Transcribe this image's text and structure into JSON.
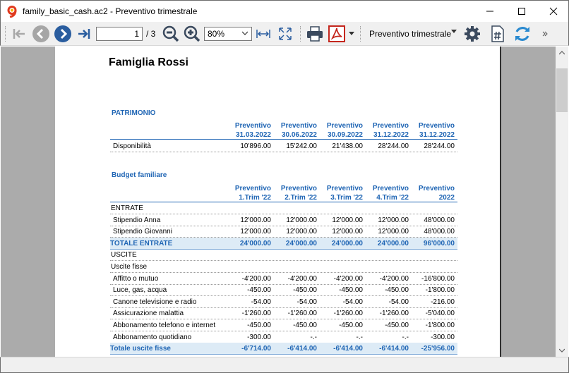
{
  "window": {
    "title": "family_basic_cash.ac2 - Preventivo trimestrale",
    "app_icon_color": "#e03a1e"
  },
  "toolbar": {
    "current_page": "1",
    "page_total": "/ 3",
    "zoom": "80%",
    "report_name": "Preventivo trimestrale"
  },
  "report": {
    "title": "Famiglia Rossi",
    "patrimonio": {
      "heading": "PATRIMONIO",
      "columns": [
        {
          "line1": "Preventivo",
          "line2": "31.03.2022"
        },
        {
          "line1": "Preventivo",
          "line2": "30.06.2022"
        },
        {
          "line1": "Preventivo",
          "line2": "30.09.2022"
        },
        {
          "line1": "Preventivo",
          "line2": "31.12.2022"
        },
        {
          "line1": "Preventivo",
          "line2": "31.12.2022"
        }
      ],
      "rows": [
        {
          "label": "Disponibilità",
          "values": [
            "10'896.00",
            "15'242.00",
            "21'438.00",
            "28'244.00",
            "28'244.00"
          ]
        }
      ]
    },
    "budget": {
      "heading": "Budget familiare",
      "columns": [
        {
          "line1": "Preventivo",
          "line2": "1.Trim '22"
        },
        {
          "line1": "Preventivo",
          "line2": "2.Trim '22"
        },
        {
          "line1": "Preventivo",
          "line2": "3.Trim '22"
        },
        {
          "line1": "Preventivo",
          "line2": "4.Trim '22"
        },
        {
          "line1": "Preventivo",
          "line2": "2022"
        }
      ],
      "rows": [
        {
          "label": "ENTRATE",
          "kind": "group",
          "values": [
            "",
            "",
            "",
            "",
            ""
          ]
        },
        {
          "label": "Stipendio Anna",
          "kind": "item",
          "values": [
            "12'000.00",
            "12'000.00",
            "12'000.00",
            "12'000.00",
            "48'000.00"
          ]
        },
        {
          "label": "Stipendio Giovanni",
          "kind": "item",
          "values": [
            "12'000.00",
            "12'000.00",
            "12'000.00",
            "12'000.00",
            "48'000.00"
          ]
        },
        {
          "label": "TOTALE ENTRATE",
          "kind": "total",
          "values": [
            "24'000.00",
            "24'000.00",
            "24'000.00",
            "24'000.00",
            "96'000.00"
          ]
        },
        {
          "label": "USCITE",
          "kind": "group",
          "values": [
            "",
            "",
            "",
            "",
            ""
          ]
        },
        {
          "label": "Uscite fisse",
          "kind": "group",
          "values": [
            "",
            "",
            "",
            "",
            ""
          ]
        },
        {
          "label": "Affitto o mutuo",
          "kind": "item",
          "values": [
            "-4'200.00",
            "-4'200.00",
            "-4'200.00",
            "-4'200.00",
            "-16'800.00"
          ]
        },
        {
          "label": "Luce, gas, acqua",
          "kind": "item",
          "values": [
            "-450.00",
            "-450.00",
            "-450.00",
            "-450.00",
            "-1'800.00"
          ]
        },
        {
          "label": "Canone televisione e radio",
          "kind": "item",
          "values": [
            "-54.00",
            "-54.00",
            "-54.00",
            "-54.00",
            "-216.00"
          ]
        },
        {
          "label": "Assicurazione malattia",
          "kind": "item",
          "values": [
            "-1'260.00",
            "-1'260.00",
            "-1'260.00",
            "-1'260.00",
            "-5'040.00"
          ]
        },
        {
          "label": "Abbonamento telefono e internet",
          "kind": "item",
          "values": [
            "-450.00",
            "-450.00",
            "-450.00",
            "-450.00",
            "-1'800.00"
          ]
        },
        {
          "label": "Abbonamento quotidiano",
          "kind": "item",
          "values": [
            "-300.00",
            "-.-",
            "-.-",
            "-.-",
            "-300.00"
          ]
        },
        {
          "label": "Totale uscite fisse",
          "kind": "total",
          "values": [
            "-6'714.00",
            "-6'414.00",
            "-6'414.00",
            "-6'414.00",
            "-25'956.00"
          ]
        }
      ]
    }
  }
}
